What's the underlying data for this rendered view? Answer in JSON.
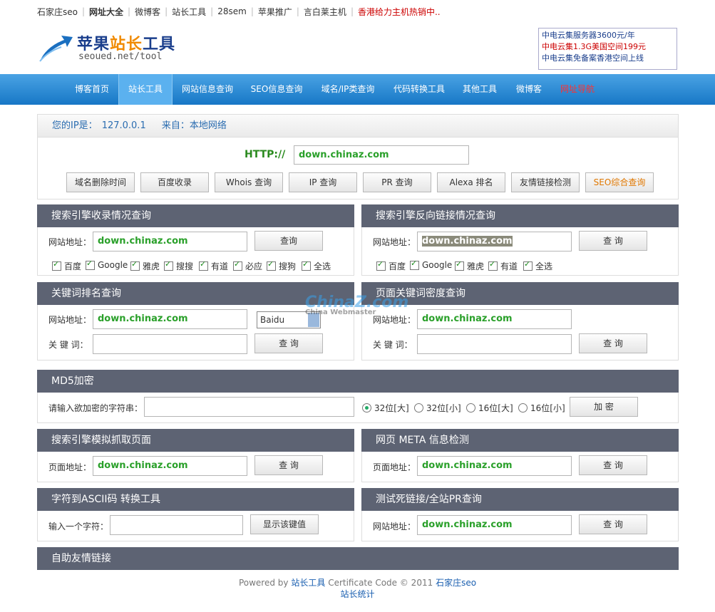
{
  "topbar": [
    "石家庄seo",
    "网址大全",
    "微博客",
    "站长工具",
    "28sem",
    "苹果推广",
    "言白莱主机",
    "香港给力主机热销中.."
  ],
  "logo": {
    "title_a": "苹果",
    "title_b": "站长",
    "title_c": "工具",
    "url": "seoued.net/tool"
  },
  "ad": [
    "中电云集服务器3600元/年",
    "中电云集1.3G美国空间199元",
    "中电云集免备案香港空间上线"
  ],
  "nav": [
    "博客首页",
    "站长工具",
    "网站信息查询",
    "SEO信息查询",
    "域名/IP类查询",
    "代码转换工具",
    "其他工具",
    "微博客",
    "网址导航"
  ],
  "ip": {
    "label": "您的IP是：",
    "value": "127.0.0.1",
    "from_label": "来自：",
    "from_value": "本地网络"
  },
  "http": {
    "label": "HTTP://",
    "value": "down.chinaz.com"
  },
  "tool_buttons": [
    "域名删除时间",
    "百度收录",
    "Whois 查询",
    "IP 查询",
    "PR 查询",
    "Alexa 排名",
    "友情链接检测",
    "SEO综合查询"
  ],
  "panel1": {
    "title": "搜索引擎收录情况查询",
    "label": "网站地址：",
    "value": "down.chinaz.com",
    "button": "查询",
    "checks": [
      "百度",
      "Google",
      "雅虎",
      "搜搜",
      "有道",
      "必应",
      "搜狗",
      "全选"
    ]
  },
  "panel2": {
    "title": "搜索引擎反向链接情况查询",
    "label": "网站地址：",
    "value": "down.chinaz.com",
    "button": "查 询",
    "checks": [
      "百度",
      "Google",
      "雅虎",
      "有道",
      "全选"
    ]
  },
  "panel3": {
    "title": "关键词排名查询",
    "label": "网站地址：",
    "value": "down.chinaz.com",
    "select": "Baidu",
    "kw_label": "关 键 词：",
    "button": "查 询"
  },
  "panel4": {
    "title": "页面关键词密度查询",
    "label": "网站地址：",
    "value": "down.chinaz.com",
    "kw_label": "关 键 词：",
    "button": "查 询"
  },
  "md5": {
    "title": "MD5加密",
    "label": "请输入欲加密的字符串：",
    "radios": [
      "32位[大]",
      "32位[小]",
      "16位[大]",
      "16位[小]"
    ],
    "button": "加 密"
  },
  "panel5": {
    "title": "搜索引擎模拟抓取页面",
    "label": "页面地址：",
    "value": "down.chinaz.com",
    "button": "查 询"
  },
  "panel6": {
    "title": "网页 META 信息检测",
    "label": "页面地址：",
    "value": "down.chinaz.com",
    "button": "查 询"
  },
  "panel7": {
    "title": "字符到ASCII码 转换工具",
    "label": "输入一个字符：",
    "button": "显示该键值"
  },
  "panel8": {
    "title": "测试死链接/全站PR查询",
    "label": "网站地址：",
    "value": "down.chinaz.com",
    "button": "查 询"
  },
  "links": {
    "title": "自助友情链接"
  },
  "footer": {
    "powered": "Powered by",
    "tool": "站长工具",
    "cert": "Certificate Code © 2011",
    "seo": "石家庄seo",
    "stats": "站长统计"
  },
  "watermark": {
    "main": "ChinaZ.com",
    "sub": "China Webmaster"
  }
}
